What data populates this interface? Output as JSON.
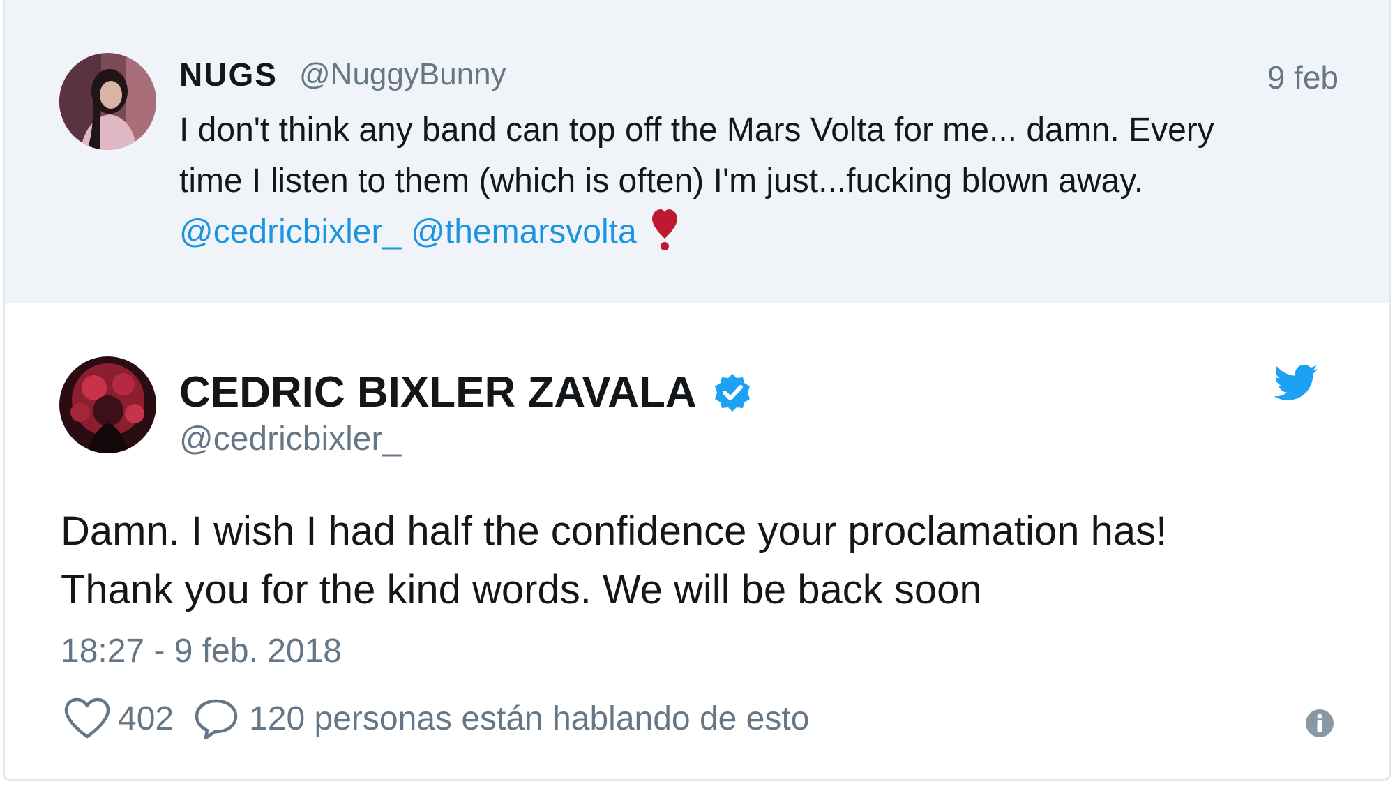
{
  "parent_tweet": {
    "display_name": "NUGS",
    "handle": "@NuggyBunny",
    "date": "9 feb",
    "text_lines": [
      "I don't think any band can top off the Mars Volta for me... damn. Every",
      "time I listen to them (which is often) I'm just...fucking blown away."
    ],
    "mentions": [
      "@cedricbixler_",
      "@themarsvolta"
    ],
    "emoji_icon": "heavy-heart-exclamation-icon"
  },
  "main_tweet": {
    "display_name": "CEDRIC BIXLER ZAVALA",
    "handle": "@cedricbixler_",
    "verified_icon": "verified-badge-icon",
    "brand_icon": "twitter-bird-icon",
    "text_lines": [
      "Damn. I wish I had half the confidence your proclamation has!",
      "Thank you for the kind words. We will be back soon"
    ],
    "timestamp": "18:27 - 9 feb. 2018",
    "likes": "402",
    "conversation_text": "120 personas están hablando de esto",
    "info_icon": "info-icon"
  },
  "colors": {
    "link": "#1b95e0",
    "secondary_text": "#657786",
    "primary_text": "#14171a",
    "parent_background": "#f0f3f7",
    "twitter_blue": "#1da1f2",
    "heart_red": "#be1931"
  }
}
